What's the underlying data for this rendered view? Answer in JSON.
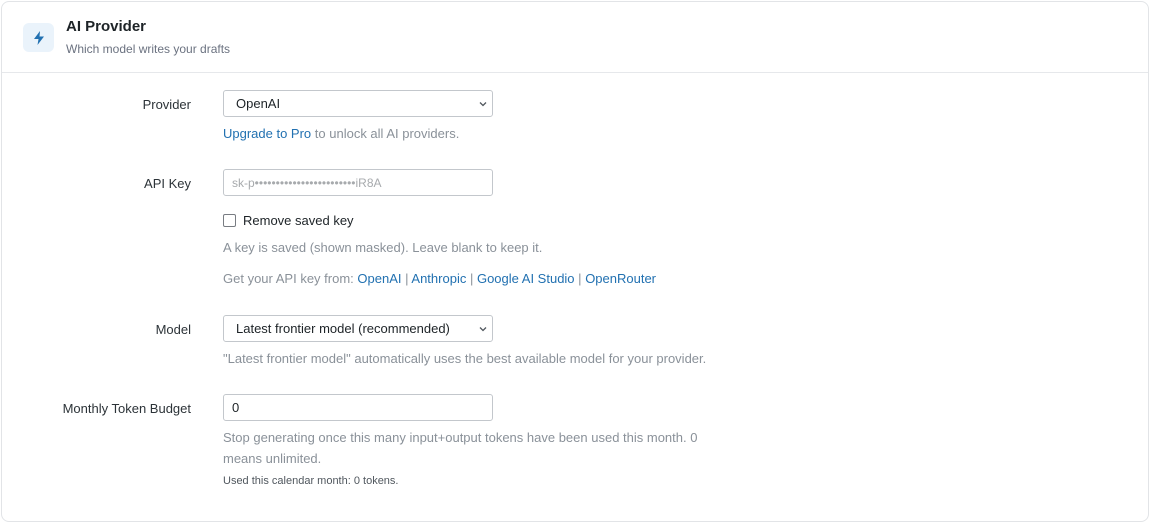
{
  "header": {
    "title": "AI Provider",
    "subtitle": "Which model writes your drafts",
    "icon": "lightning-bolt-icon",
    "accent": "#2271b1"
  },
  "provider": {
    "label": "Provider",
    "selected": "OpenAI",
    "upgrade_link": "Upgrade to Pro",
    "upgrade_suffix": " to unlock all AI providers."
  },
  "api_key": {
    "label": "API Key",
    "value": "sk-p••••••••••••••••••••••••iR8A",
    "remove_label": "Remove saved key",
    "remove_checked": false,
    "saved_note": "A key is saved (shown masked). Leave blank to keep it.",
    "get_key_prefix": "Get your API key from: ",
    "links": [
      "OpenAI",
      "Anthropic",
      "Google AI Studio",
      "OpenRouter"
    ],
    "separator": "|"
  },
  "model": {
    "label": "Model",
    "selected": "Latest frontier model (recommended)",
    "help": "\"Latest frontier model\" automatically uses the best available model for your provider."
  },
  "budget": {
    "label": "Monthly Token Budget",
    "value": "0",
    "help_line1": "Stop generating once this many input+output tokens have been used this month. 0",
    "help_line2": "means unlimited.",
    "usage": "Used this calendar month: 0 tokens."
  }
}
